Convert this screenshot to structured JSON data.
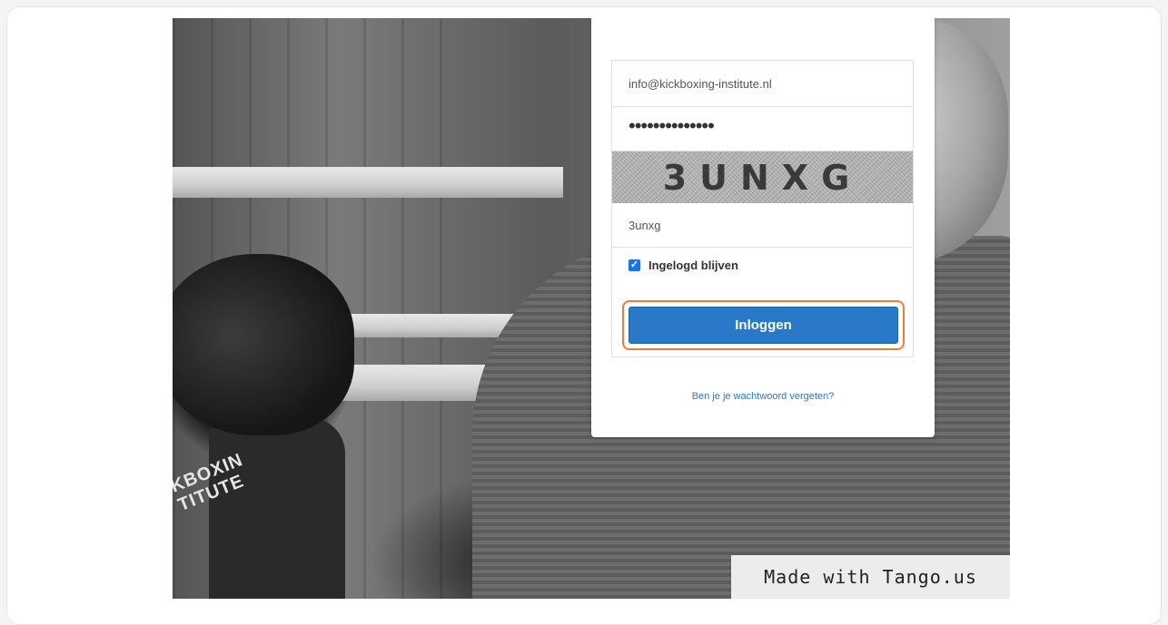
{
  "login_form": {
    "email_value": "info@kickboxing-institute.nl",
    "password_mask": "••••••••••••••",
    "captcha_text": "3UNXG",
    "captcha_input_value": "3unxg",
    "remember_label": "Ingelogd blijven",
    "remember_checked": true,
    "submit_label": "Inloggen",
    "forgot_link": "Ben je je wachtwoord vergeten?"
  },
  "background": {
    "shirt_text": "KBOXIN\nTITUTE"
  },
  "watermark": {
    "text": "Made with Tango.us"
  },
  "colors": {
    "accent": "#2a78c8",
    "highlight": "#f07a3a"
  }
}
